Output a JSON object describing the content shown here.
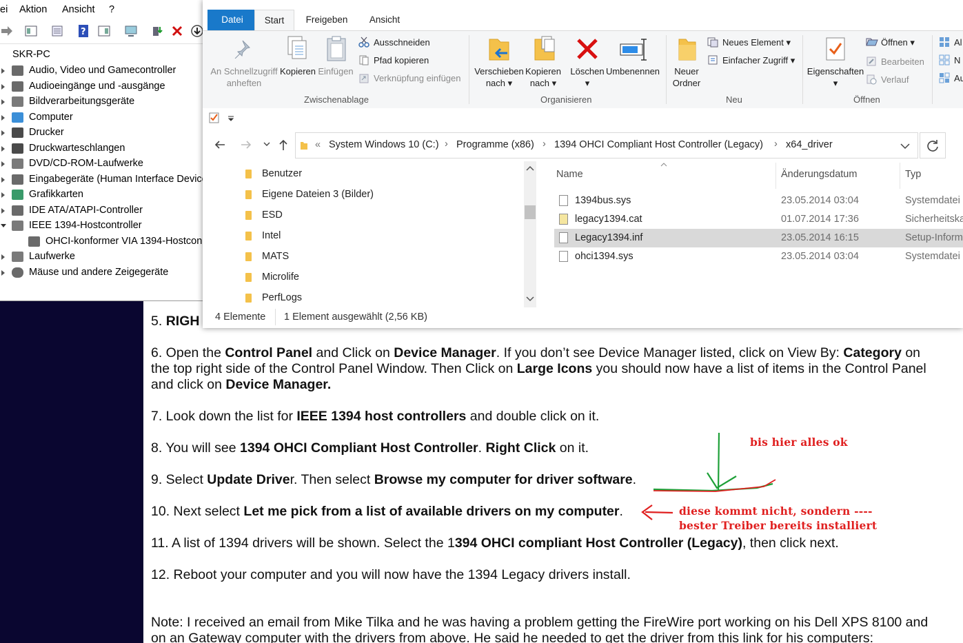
{
  "device_manager": {
    "menu": [
      "ei",
      "Aktion",
      "Ansicht",
      "?"
    ],
    "root": "SKR-PC",
    "items": [
      {
        "label": "Audio, Video und Gamecontroller",
        "icon": "speaker-icon"
      },
      {
        "label": "Audioeingänge und -ausgänge",
        "icon": "audio-io-icon"
      },
      {
        "label": "Bildverarbeitungsgeräte",
        "icon": "camera-icon"
      },
      {
        "label": "Computer",
        "icon": "monitor-icon"
      },
      {
        "label": "Drucker",
        "icon": "printer-icon"
      },
      {
        "label": "Druckwarteschlangen",
        "icon": "print-queue-icon"
      },
      {
        "label": "DVD/CD-ROM-Laufwerke",
        "icon": "disc-drive-icon"
      },
      {
        "label": "Eingabegeräte (Human Interface Device",
        "icon": "hid-icon"
      },
      {
        "label": "Grafikkarten",
        "icon": "display-adapter-icon"
      },
      {
        "label": "IDE ATA/ATAPI-Controller",
        "icon": "ide-controller-icon"
      },
      {
        "label": "IEEE 1394-Hostcontroller",
        "icon": "firewire-icon"
      },
      {
        "label": "OHCI-konformer VIA 1394-Hostcon",
        "icon": "firewire-device-icon"
      },
      {
        "label": "Laufwerke",
        "icon": "drive-icon"
      },
      {
        "label": "Mäuse und andere Zeigegeräte",
        "icon": "mouse-icon"
      }
    ]
  },
  "explorer": {
    "tabs": {
      "datei": "Datei",
      "start": "Start",
      "freigeben": "Freigeben",
      "ansicht": "Ansicht"
    },
    "ribbon": {
      "pin_line1": "An Schnellzugriff",
      "pin_line2": "anheften",
      "copy": "Kopieren",
      "paste": "Einfügen",
      "cut": "Ausschneiden",
      "copy_path": "Pfad kopieren",
      "paste_shortcut": "Verknüpfung einfügen",
      "group_clipboard": "Zwischenablage",
      "move_line1": "Verschieben",
      "move_line2": "nach",
      "copyto_line1": "Kopieren",
      "copyto_line2": "nach",
      "delete": "Löschen",
      "rename": "Umbenennen",
      "group_organize": "Organisieren",
      "newfolder_line1": "Neuer",
      "newfolder_line2": "Ordner",
      "new_item": "Neues Element",
      "easy_access": "Einfacher Zugriff",
      "group_new": "Neu",
      "properties": "Eigenschaften",
      "open": "Öffnen",
      "edit": "Bearbeiten",
      "history": "Verlauf",
      "group_open": "Öffnen",
      "sel_all": "Al",
      "sel_none": "N",
      "sel_invert": "Au"
    },
    "address": {
      "prefix": "«",
      "segments": [
        "System Windows 10 (C:)",
        "Programme (x86)",
        "1394 OHCI Compliant Host Controller (Legacy)",
        "x64_driver"
      ]
    },
    "nav_folders": [
      "Benutzer",
      "Eigene Dateien 3 (Bilder)",
      "ESD",
      "Intel",
      "MATS",
      "Microlife",
      "PerfLogs"
    ],
    "columns": {
      "name": "Name",
      "date": "Änderungsdatum",
      "type": "Typ"
    },
    "files": [
      {
        "name": "1394bus.sys",
        "date": "23.05.2014 03:04",
        "type": "Systemdatei",
        "selected": false
      },
      {
        "name": "legacy1394.cat",
        "date": "01.07.2014 17:36",
        "type": "Sicherheitska",
        "selected": false
      },
      {
        "name": "Legacy1394.inf",
        "date": "23.05.2014 16:15",
        "type": "Setup-Inform",
        "selected": true
      },
      {
        "name": "ohci1394.sys",
        "date": "23.05.2014 03:04",
        "type": "Systemdatei",
        "selected": false
      }
    ],
    "status": {
      "count": "4 Elemente",
      "selection": "1 Element ausgewählt (2,56 KB)"
    }
  },
  "document": {
    "s5": {
      "num": "5.  ",
      "bold": "RIGH"
    },
    "s6": {
      "a": "6.  Open the ",
      "b": "Control Panel",
      "c": " and Click on ",
      "d": "Device Manager",
      "e": ".  If you don’t see Device Manager listed, click on View By: ",
      "f": "Category",
      "g": " on",
      "l2a": "the top right side of the Control Panel Window.  Then Click on ",
      "l2b": "Large Icons",
      "l2c": " you should now have a list of items in the Control Panel",
      "l3a": "and click on ",
      "l3b": "Device Manager."
    },
    "s7": {
      "a": "7. Look down the list for ",
      "b": "IEEE 1394 host controllers",
      "c": " and double click on it."
    },
    "s8": {
      "a": "8.  You will see ",
      "b": "1394 OHCI Compliant Host Controller",
      "c": ".  ",
      "d": "Right Click",
      "e": " on it."
    },
    "s9": {
      "a": "9.  Select ",
      "b": "Update Drive",
      "c": "r.  Then select ",
      "d": "Browse my computer for driver software",
      "e": "."
    },
    "s10": {
      "a": "10. Next select ",
      "b": "Let me pick from a list of available drivers on my computer",
      "c": "."
    },
    "s11": {
      "a": "11. A list of 1394 drivers will be shown.  Select the 1",
      "b": "394 OHCI compliant Host Controller (Legacy)",
      "c": ", then click next."
    },
    "s12": "12. Reboot your computer and you will now have the 1394 Legacy drivers install.",
    "note1": "Note: I received an email from Mike Tilka and he was having a problem getting the FireWire port working on his Dell XPS 8100 and",
    "note2": "on an Gateway computer with the drivers from above.  He said he needed to get the driver from this link for his computers:"
  },
  "annotations": {
    "ok": "bis hier alles ok",
    "line1": "diese kommt nicht, sondern ----",
    "line2": "bester Treiber bereits installiert",
    "colors": {
      "red": "#e02020",
      "green": "#1ea038"
    }
  }
}
